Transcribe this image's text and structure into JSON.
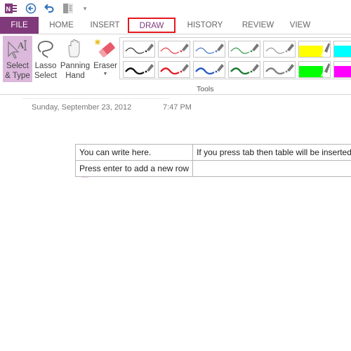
{
  "quick_access": {
    "app_icon": "onenote-icon",
    "back": "back-arrow-icon",
    "undo": "undo-icon",
    "dock": "dock-to-desktop-icon",
    "customize": "customize-toolbar-icon"
  },
  "tabs": [
    {
      "label": "FILE"
    },
    {
      "label": "HOME"
    },
    {
      "label": "INSERT"
    },
    {
      "label": "DRAW",
      "active": true,
      "highlighted": true
    },
    {
      "label": "HISTORY"
    },
    {
      "label": "REVIEW"
    },
    {
      "label": "VIEW"
    }
  ],
  "ribbon": {
    "tools": [
      {
        "line1": "Select",
        "line2": "& Type",
        "icon": "select-type-icon",
        "selected": true
      },
      {
        "line1": "Lasso",
        "line2": "Select",
        "icon": "lasso-icon"
      },
      {
        "line1": "Panning",
        "line2": "Hand",
        "icon": "hand-icon"
      },
      {
        "line1": "Eraser",
        "line2": "",
        "icon": "eraser-icon",
        "dropdown": true
      }
    ],
    "pens": [
      {
        "row": 0,
        "kind": "pen",
        "color": "#333333",
        "weight": "thin"
      },
      {
        "row": 0,
        "kind": "pen",
        "color": "#e0424a",
        "weight": "thin"
      },
      {
        "row": 0,
        "kind": "pen",
        "color": "#4a78c8",
        "weight": "thin"
      },
      {
        "row": 0,
        "kind": "pen",
        "color": "#3a9a4a",
        "weight": "thin"
      },
      {
        "row": 0,
        "kind": "pen",
        "color": "#999999",
        "weight": "thin"
      },
      {
        "row": 0,
        "kind": "highlighter",
        "color": "#ffff00"
      },
      {
        "row": 0,
        "kind": "highlighter",
        "color": "#00ffff"
      },
      {
        "row": 1,
        "kind": "pen",
        "color": "#111111",
        "weight": "thick"
      },
      {
        "row": 1,
        "kind": "pen",
        "color": "#e0202a",
        "weight": "thick"
      },
      {
        "row": 1,
        "kind": "pen",
        "color": "#2a5cc0",
        "weight": "thick"
      },
      {
        "row": 1,
        "kind": "pen",
        "color": "#1e7a30",
        "weight": "thick"
      },
      {
        "row": 1,
        "kind": "pen",
        "color": "#808080",
        "weight": "thick"
      },
      {
        "row": 1,
        "kind": "highlighter",
        "color": "#00ff00"
      },
      {
        "row": 1,
        "kind": "highlighter",
        "color": "#ff00ff"
      }
    ],
    "group_label": "Tools"
  },
  "page": {
    "date": "Sunday, September 23, 2012",
    "time": "7:47 PM",
    "table": [
      [
        "You can write here.",
        "If you press tab then table will be inserted"
      ],
      [
        "Press enter to add a new row",
        ""
      ]
    ]
  },
  "colors": {
    "accent": "#80397b",
    "highlight_box": "#e5191f",
    "selected_tool_bg": "#dcb8dc"
  }
}
